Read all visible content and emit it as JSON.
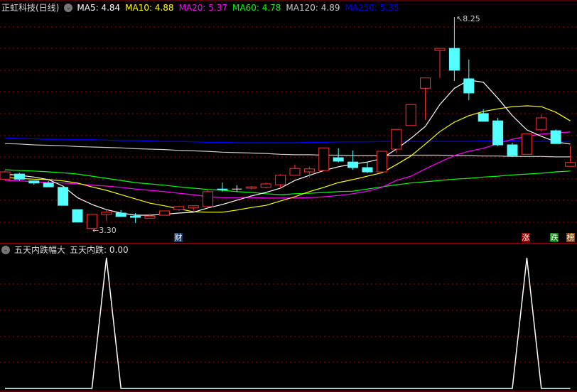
{
  "header": {
    "title": "正虹科技(日线)",
    "ma": [
      {
        "label": "MA5: 4.84",
        "color": "#ffffff"
      },
      {
        "label": "MA10: 4.88",
        "color": "#ffff00"
      },
      {
        "label": "MA20: 5.37",
        "color": "#ff00ff"
      },
      {
        "label": "MA60: 4.78",
        "color": "#00ff00"
      },
      {
        "label": "MA120: 4.89",
        "color": "#cccccc"
      },
      {
        "label": "MA250: 5.35",
        "color": "#0000ff"
      }
    ]
  },
  "subpane": {
    "title": "五天内跌幅大",
    "value_label": "五天内跌: 0.00"
  },
  "tags": {
    "finance": "财",
    "rise": "涨",
    "fall": "跌",
    "rank": "榜"
  },
  "annotations": {
    "high": "8.25",
    "low": "3.30"
  },
  "colors": {
    "up": "#ff3333",
    "down": "#54ffff",
    "grid": "#a00000"
  },
  "chart_data": {
    "type": "candlestick",
    "price_range": [
      3.0,
      8.6
    ],
    "candles": [
      [
        4.47,
        4.64,
        4.67,
        4.44
      ],
      [
        4.59,
        4.47,
        4.62,
        4.43
      ],
      [
        4.43,
        4.38,
        4.44,
        4.34
      ],
      [
        4.38,
        4.29,
        4.43,
        4.29
      ],
      [
        4.28,
        3.86,
        4.28,
        3.86
      ],
      [
        3.76,
        3.47,
        3.76,
        3.47
      ],
      [
        3.32,
        3.65,
        3.65,
        3.3
      ],
      [
        3.65,
        3.7,
        3.76,
        3.5
      ],
      [
        3.68,
        3.6,
        3.75,
        3.6
      ],
      [
        3.61,
        3.58,
        3.68,
        3.45
      ],
      [
        3.56,
        3.61,
        3.65,
        3.56
      ],
      [
        3.63,
        3.73,
        3.73,
        3.63
      ],
      [
        3.76,
        3.83,
        3.85,
        3.73
      ],
      [
        3.8,
        3.85,
        3.86,
        3.73
      ],
      [
        3.83,
        4.18,
        4.21,
        3.83
      ],
      [
        4.24,
        4.23,
        4.39,
        4.18
      ],
      [
        4.24,
        4.24,
        4.33,
        4.18
      ],
      [
        4.26,
        4.29,
        4.31,
        4.23
      ],
      [
        4.28,
        4.36,
        4.39,
        4.26
      ],
      [
        4.34,
        4.56,
        4.59,
        4.26
      ],
      [
        4.56,
        4.72,
        4.81,
        4.56
      ],
      [
        4.64,
        4.71,
        4.76,
        4.51
      ],
      [
        4.67,
        5.2,
        5.2,
        4.67
      ],
      [
        4.97,
        4.89,
        5.19,
        4.86
      ],
      [
        4.87,
        4.74,
        5.14,
        4.69
      ],
      [
        4.74,
        4.64,
        4.87,
        4.61
      ],
      [
        4.64,
        5.12,
        5.12,
        4.64
      ],
      [
        5.17,
        5.63,
        5.63,
        5.07
      ],
      [
        5.72,
        6.21,
        6.21,
        5.72
      ],
      [
        6.59,
        6.83,
        6.83,
        5.85
      ],
      [
        7.47,
        7.52,
        7.52,
        6.83
      ],
      [
        7.52,
        7.01,
        8.25,
        6.76
      ],
      [
        6.81,
        6.48,
        7.26,
        6.31
      ],
      [
        6.0,
        5.82,
        6.1,
        5.82
      ],
      [
        5.83,
        5.27,
        5.9,
        5.24
      ],
      [
        5.27,
        5.02,
        5.32,
        4.99
      ],
      [
        5.05,
        5.53,
        5.53,
        5.05
      ],
      [
        5.62,
        5.9,
        5.98,
        5.58
      ],
      [
        5.6,
        5.3,
        5.63,
        5.3
      ],
      [
        4.77,
        4.86,
        5.25,
        4.77
      ]
    ],
    "ma_series": [
      {
        "name": "MA250",
        "color": "#0000ff",
        "values": [
          5.43,
          5.42,
          5.41,
          5.4,
          5.4,
          5.39,
          5.39,
          5.38,
          5.37,
          5.37,
          5.36,
          5.35,
          5.35,
          5.34,
          5.33,
          5.33,
          5.32,
          5.32,
          5.32,
          5.32,
          5.32,
          5.33,
          5.33,
          5.34,
          5.34,
          5.34,
          5.35,
          5.35,
          5.35,
          5.35,
          5.35,
          5.35,
          5.35,
          5.36,
          5.36,
          5.36,
          5.35,
          5.35,
          5.35,
          5.35
        ]
      },
      {
        "name": "MA120",
        "color": "#cccccc",
        "values": [
          5.3,
          5.29,
          5.27,
          5.26,
          5.25,
          5.23,
          5.22,
          5.21,
          5.2,
          5.18,
          5.17,
          5.16,
          5.14,
          5.13,
          5.12,
          5.1,
          5.09,
          5.08,
          5.07,
          5.05,
          5.04,
          5.04,
          5.03,
          5.03,
          5.02,
          5.02,
          5.02,
          5.02,
          5.03,
          5.03,
          5.03,
          5.02,
          5.02,
          5.01,
          5.01,
          5.0,
          5.0,
          5.0,
          4.99,
          4.99
        ]
      },
      {
        "name": "MA60",
        "color": "#00ff00",
        "values": [
          4.69,
          4.67,
          4.66,
          4.64,
          4.62,
          4.59,
          4.54,
          4.49,
          4.44,
          4.39,
          4.36,
          4.33,
          4.29,
          4.26,
          4.23,
          4.21,
          4.18,
          4.16,
          4.13,
          4.11,
          4.13,
          4.14,
          4.16,
          4.18,
          4.19,
          4.24,
          4.29,
          4.34,
          4.38,
          4.41,
          4.44,
          4.47,
          4.49,
          4.52,
          4.54,
          4.57,
          4.59,
          4.61,
          4.64,
          4.66
        ]
      },
      {
        "name": "MA20",
        "color": "#ff00ff",
        "values": [
          4.44,
          4.43,
          4.41,
          4.39,
          4.38,
          4.36,
          4.33,
          4.31,
          4.28,
          4.24,
          4.21,
          4.18,
          4.14,
          4.11,
          4.06,
          4.04,
          4.04,
          4.04,
          4.03,
          4.03,
          4.03,
          4.04,
          4.06,
          4.09,
          4.13,
          4.19,
          4.28,
          4.44,
          4.54,
          4.71,
          4.87,
          5.02,
          5.12,
          5.19,
          5.3,
          5.4,
          5.47,
          5.52,
          5.55,
          5.57
        ]
      },
      {
        "name": "MA10",
        "color": "#ffff00",
        "values": [
          4.51,
          4.49,
          4.47,
          4.46,
          4.43,
          4.38,
          4.29,
          4.21,
          4.11,
          4.01,
          3.91,
          3.85,
          3.78,
          3.71,
          3.7,
          3.7,
          3.75,
          3.81,
          3.86,
          3.96,
          4.06,
          4.18,
          4.28,
          4.39,
          4.46,
          4.54,
          4.62,
          4.81,
          5.01,
          5.29,
          5.58,
          5.8,
          5.95,
          6.05,
          6.11,
          6.16,
          6.18,
          6.16,
          6.03,
          5.83
        ]
      },
      {
        "name": "MA5",
        "color": "#ffffff",
        "values": [
          4.59,
          4.56,
          4.52,
          4.46,
          4.31,
          4.04,
          3.88,
          3.76,
          3.68,
          3.63,
          3.63,
          3.65,
          3.68,
          3.7,
          3.8,
          3.88,
          3.98,
          4.08,
          4.16,
          4.26,
          4.44,
          4.56,
          4.67,
          4.76,
          4.82,
          4.87,
          4.95,
          5.17,
          5.42,
          5.7,
          6.21,
          6.59,
          6.78,
          6.73,
          6.36,
          5.95,
          5.62,
          5.47,
          5.34,
          5.29
        ]
      }
    ],
    "indicator": {
      "name": "五天内跌",
      "range": [
        0,
        1
      ],
      "values": [
        0,
        0,
        0,
        0,
        0,
        0,
        0,
        1,
        0,
        0,
        0,
        0,
        0,
        0,
        0,
        0,
        0,
        0,
        0,
        0,
        0,
        0,
        0,
        0,
        0,
        0,
        0,
        0,
        0,
        0,
        0,
        0,
        0,
        0,
        0,
        0,
        1,
        0,
        0,
        0
      ]
    }
  }
}
